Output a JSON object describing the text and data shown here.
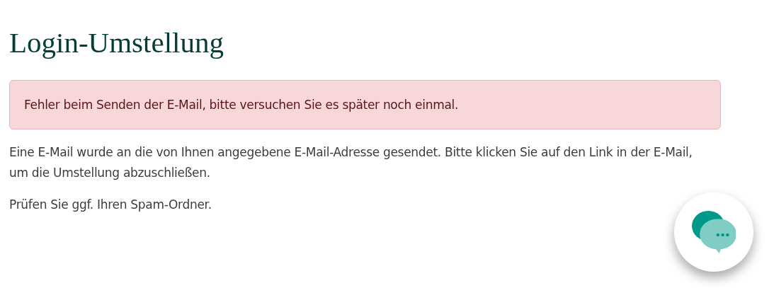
{
  "title": "Login-Umstellung",
  "alert": {
    "kind": "error",
    "text": "Fehler beim Senden der E-Mail, bitte versuchen Sie es später noch einmal."
  },
  "paragraphs": [
    "Eine E-Mail wurde an die von Ihnen angegebene E-Mail-Adresse gesendet. Bitte klicken Sie auf den Link in der E-Mail, um die Umstellung abzuschließen.",
    "Prüfen Sie ggf. Ihren Spam-Ordner."
  ],
  "chat_button": {
    "kind": "chat"
  }
}
